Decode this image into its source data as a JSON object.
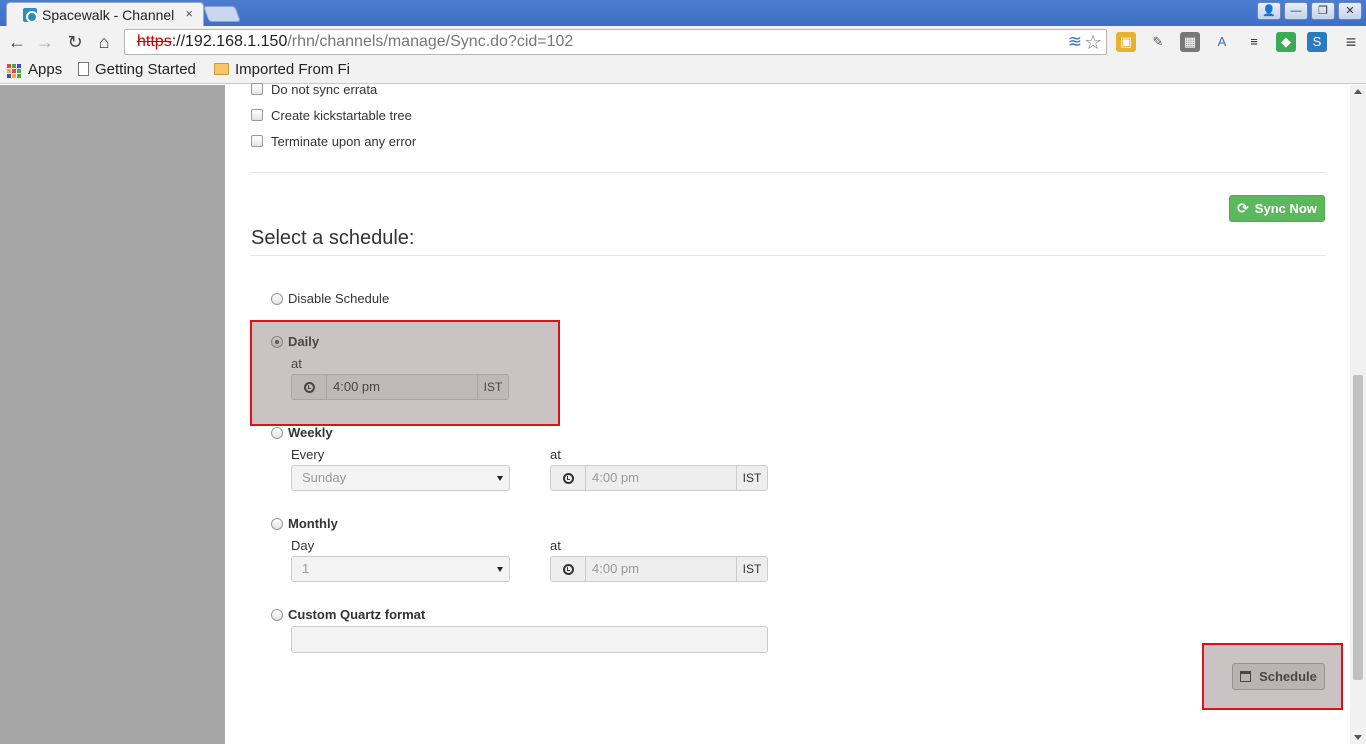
{
  "browser": {
    "tab_title": "Spacewalk - Channel",
    "tab_close": "×",
    "url_scheme": "https",
    "url_host": "://192.168.1.150",
    "url_path": "/rhn/channels/manage/Sync.do?cid=102",
    "window_buttons": [
      "👤",
      "—",
      "❐",
      "✕"
    ],
    "nav": {
      "back": "←",
      "forward": "→",
      "reload": "↻",
      "home": "⌂",
      "menu": "≡"
    },
    "star": "☆",
    "lock_glyph": "✕"
  },
  "bookmarks": {
    "apps_label": "Apps",
    "items": [
      {
        "label": "Getting Started",
        "icon": "page-icon"
      },
      {
        "label": "Imported From Fi",
        "icon": "folder-icon"
      }
    ]
  },
  "options": {
    "checkboxes": [
      {
        "label": "Do not sync errata",
        "checked": false
      },
      {
        "label": "Create kickstartable tree",
        "checked": false
      },
      {
        "label": "Terminate upon any error",
        "checked": false
      }
    ]
  },
  "sync_button": {
    "label": "Sync Now",
    "icon": "refresh-icon",
    "color": "#5cb85c"
  },
  "schedule": {
    "heading": "Select a schedule:",
    "disable_label": "Disable Schedule",
    "daily": {
      "label": "Daily",
      "at_label": "at",
      "time": "4:00 pm",
      "tz": "IST",
      "selected": true
    },
    "weekly": {
      "label": "Weekly",
      "every_label": "Every",
      "day": "Sunday",
      "at_label": "at",
      "time": "4:00 pm",
      "tz": "IST"
    },
    "monthly": {
      "label": "Monthly",
      "day_label": "Day",
      "day": "1",
      "at_label": "at",
      "time": "4:00 pm",
      "tz": "IST"
    },
    "custom": {
      "label": "Custom Quartz format",
      "value": ""
    },
    "submit_label": "Schedule"
  },
  "highlight_color": "#e0101a"
}
